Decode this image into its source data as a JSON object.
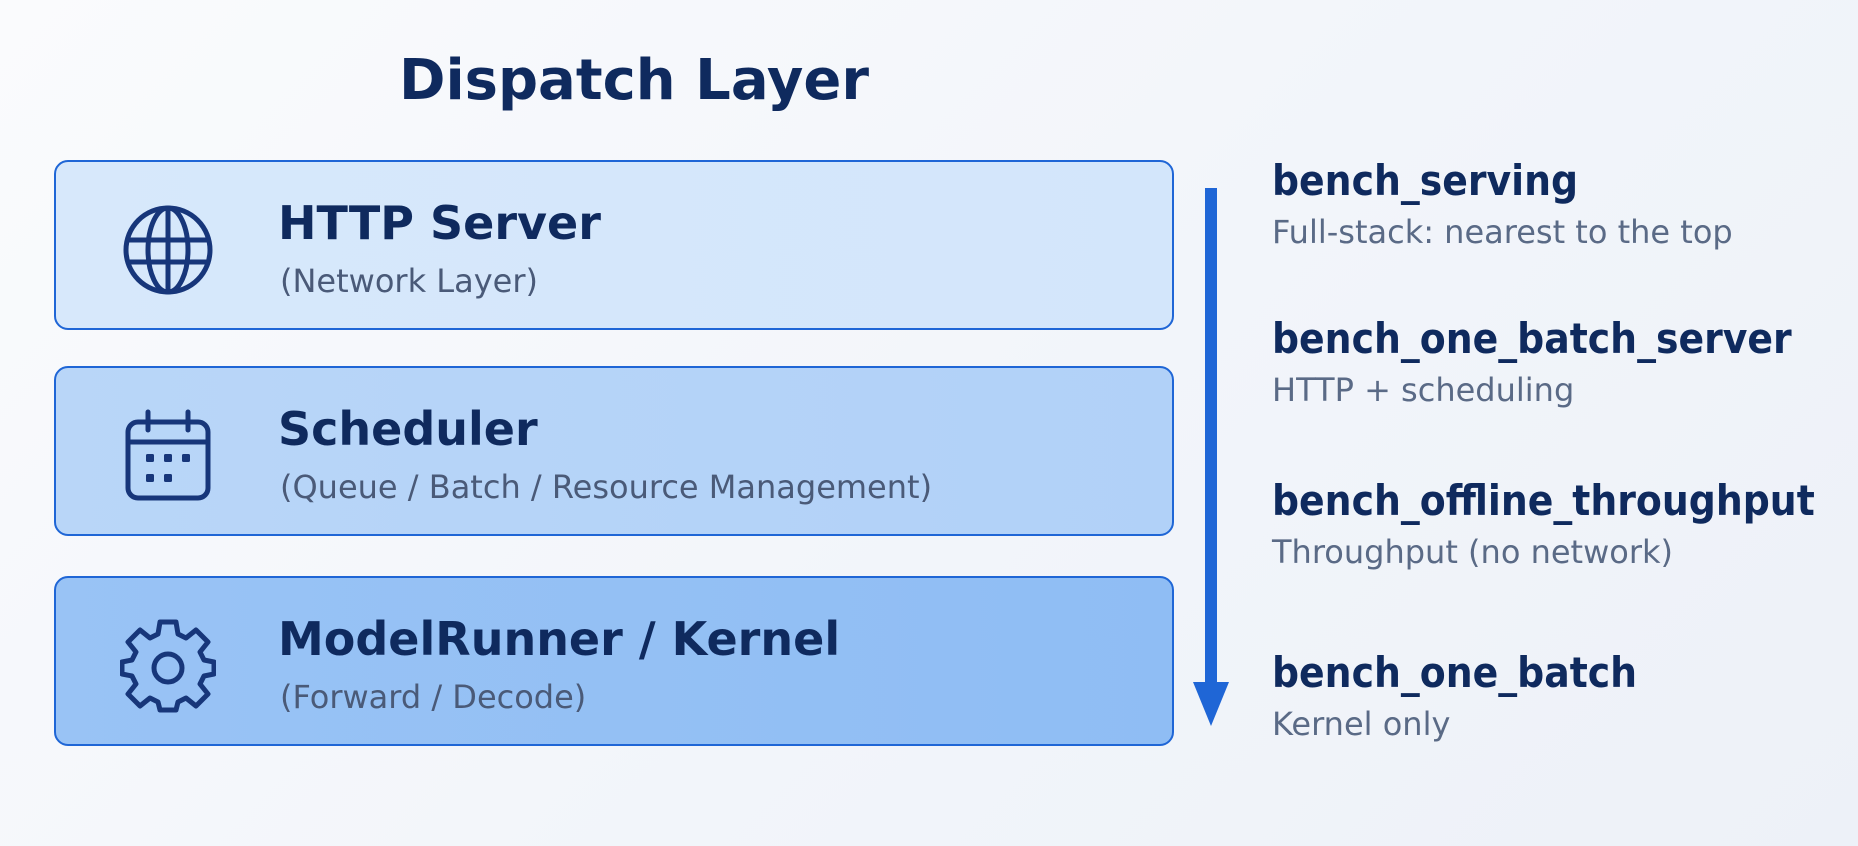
{
  "diagram": {
    "title": "Dispatch Layer",
    "layers": [
      {
        "name": "HTTP Server",
        "sub": "(Network Layer)",
        "icon": "globe-icon"
      },
      {
        "name": "Scheduler",
        "sub": "(Queue / Batch / Resource Management)",
        "icon": "calendar-icon"
      },
      {
        "name": "ModelRunner / Kernel",
        "sub": "(Forward / Decode)",
        "icon": "gear-icon"
      }
    ],
    "benchmarks": [
      {
        "name": "bench_serving",
        "desc": "Full-stack: nearest to the top"
      },
      {
        "name": "bench_one_batch_server",
        "desc": "HTTP + scheduling"
      },
      {
        "name": "bench_offline_throughput",
        "desc": "Throughput (no network)"
      },
      {
        "name": "bench_one_batch",
        "desc": "Kernel only"
      }
    ],
    "arrow_direction": "down",
    "colors": {
      "accent": "#1f66d6",
      "text_dark": "#0f2a5e",
      "layer1_fill": "#d7e8fb",
      "layer2_fill": "#b9d6f8",
      "layer3_fill": "#99c3f5"
    }
  }
}
